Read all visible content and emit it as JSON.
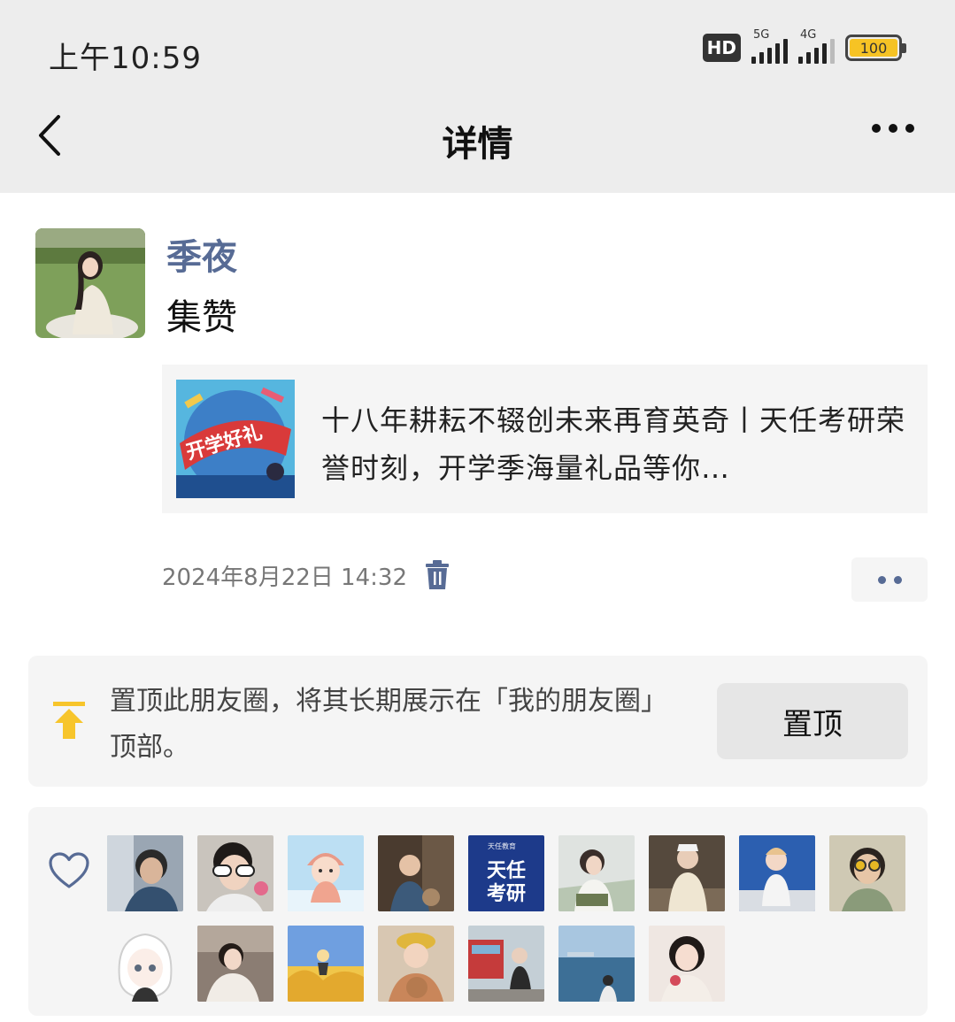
{
  "status_bar": {
    "time": "上午10:59",
    "hd_label": "HD",
    "network_5g": "5G",
    "network_4g": "4G",
    "battery_level": "100",
    "battery_color": "#f6c324"
  },
  "nav": {
    "title": "详情",
    "back_icon": "chevron-left-icon",
    "more_icon": "more-dots-icon"
  },
  "post": {
    "user_name": "季夜",
    "text": "集赞",
    "share_card": {
      "thumb_label": "开学好礼",
      "title": "十八年耕耘不辍创未来再育英奇丨天任考研荣誉时刻，开学季海量礼品等你…"
    },
    "date": "2024年8月22日 14:32",
    "delete_icon": "trash-icon",
    "action_icon": "two-dots-icon"
  },
  "pin": {
    "text": "置顶此朋友圈，将其长期展示在「我的朋友圈」顶部。",
    "button_label": "置顶",
    "icon": "pin-to-top-icon",
    "icon_color": "#f7c52b"
  },
  "likes": {
    "icon": "heart-outline-icon",
    "brand_avatar": {
      "small_text": "天任教育",
      "line1": "天任",
      "line2": "考研"
    }
  },
  "colors": {
    "link_blue": "#576b95",
    "panel_gray": "#f5f5f5",
    "header_gray": "#ededed"
  }
}
